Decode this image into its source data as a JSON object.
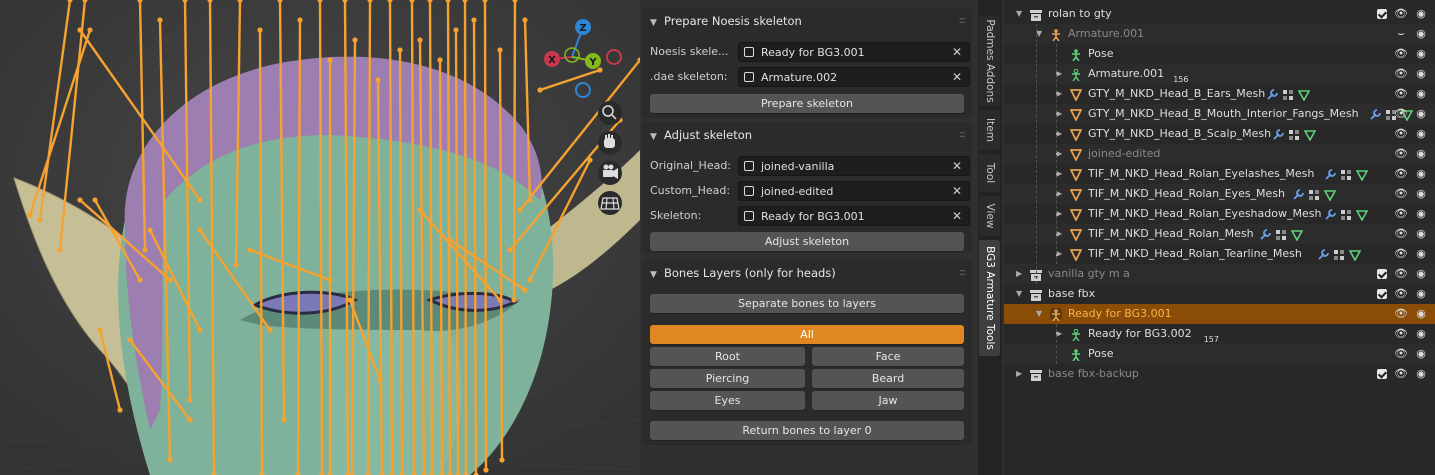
{
  "colors": {
    "accent": "#e08722",
    "bone": "#f5a230",
    "selection": "#8a4d08",
    "axis_x": "#c8374e",
    "axis_y": "#85b81c",
    "axis_z": "#2d86d6"
  },
  "viewport": {
    "gizmo": {
      "z": "Z",
      "x": "X",
      "y": "Y"
    },
    "nav_icons": [
      "zoom-icon",
      "hand-pan-icon",
      "camera-icon",
      "grid-ortho-icon"
    ]
  },
  "npanel": {
    "prepare": {
      "title": "Prepare Noesis skeleton",
      "fields": [
        {
          "label": "Noesis skele...",
          "value": "Ready for BG3.001"
        },
        {
          "label": ".dae skeleton:",
          "value": "Armature.002"
        }
      ],
      "button": "Prepare skeleton"
    },
    "adjust": {
      "title": "Adjust skeleton",
      "fields": [
        {
          "label": "Original_Head:",
          "value": "joined-vanilla"
        },
        {
          "label": "Custom_Head:",
          "value": "joined-edited"
        },
        {
          "label": "Skeleton:",
          "value": "Ready for BG3.001"
        }
      ],
      "button": "Adjust skeleton"
    },
    "layers": {
      "title": "Bones Layers (only for heads)",
      "separate": "Separate bones to layers",
      "all": "All",
      "grid": [
        "Root",
        "Face",
        "Piercing",
        "Beard",
        "Eyes",
        "Jaw"
      ],
      "return": "Return bones to layer 0"
    }
  },
  "tabs": [
    "Padmes Addons",
    "Item",
    "Tool",
    "View",
    "BG3 Armature Tools"
  ],
  "tabs_active": "BG3 Armature Tools",
  "outliner": {
    "rows": [
      {
        "name": "rolan to gty",
        "type": "collection",
        "depth": 0,
        "expanded": true,
        "dim": false
      },
      {
        "name": "Armature.001",
        "type": "armature",
        "depth": 1,
        "expanded": true,
        "dim": true
      },
      {
        "name": "Pose",
        "type": "pose",
        "depth": 2,
        "expanded": null,
        "dim": false
      },
      {
        "name": "Armature.001",
        "type": "armdata",
        "depth": 2,
        "expanded": false,
        "dim": false,
        "badge": "156"
      },
      {
        "name": "GTY_M_NKD_Head_B_Ears_Mesh",
        "type": "mesh",
        "depth": 2,
        "expanded": false,
        "dim": false
      },
      {
        "name": "GTY_M_NKD_Head_B_Mouth_Interior_Fangs_Mesh",
        "type": "mesh",
        "depth": 2,
        "expanded": false,
        "dim": false
      },
      {
        "name": "GTY_M_NKD_Head_B_Scalp_Mesh",
        "type": "mesh",
        "depth": 2,
        "expanded": false,
        "dim": false
      },
      {
        "name": "joined-edited",
        "type": "mesh",
        "depth": 2,
        "expanded": false,
        "dim": true
      },
      {
        "name": "TIF_M_NKD_Head_Rolan_Eyelashes_Mesh",
        "type": "mesh",
        "depth": 2,
        "expanded": false,
        "dim": false
      },
      {
        "name": "TIF_M_NKD_Head_Rolan_Eyes_Mesh",
        "type": "mesh",
        "depth": 2,
        "expanded": false,
        "dim": false
      },
      {
        "name": "TIF_M_NKD_Head_Rolan_Eyeshadow_Mesh",
        "type": "mesh",
        "depth": 2,
        "expanded": false,
        "dim": false
      },
      {
        "name": "TIF_M_NKD_Head_Rolan_Mesh",
        "type": "mesh",
        "depth": 2,
        "expanded": false,
        "dim": false
      },
      {
        "name": "TIF_M_NKD_Head_Rolan_Tearline_Mesh",
        "type": "mesh",
        "depth": 2,
        "expanded": false,
        "dim": false
      },
      {
        "name": "vanilla gty m a",
        "type": "collection",
        "depth": 0,
        "expanded": false,
        "dim": true
      },
      {
        "name": "base fbx",
        "type": "collection",
        "depth": 0,
        "expanded": true,
        "dim": false
      },
      {
        "name": "Ready for BG3.001",
        "type": "armature",
        "depth": 1,
        "expanded": true,
        "dim": false,
        "selected": true
      },
      {
        "name": "Ready for BG3.002",
        "type": "armdata",
        "depth": 2,
        "expanded": false,
        "dim": false,
        "badge": "157"
      },
      {
        "name": "Pose",
        "type": "pose",
        "depth": 2,
        "expanded": null,
        "dim": false
      },
      {
        "name": "base fbx-backup",
        "type": "collection",
        "depth": 0,
        "expanded": false,
        "dim": true
      }
    ]
  }
}
